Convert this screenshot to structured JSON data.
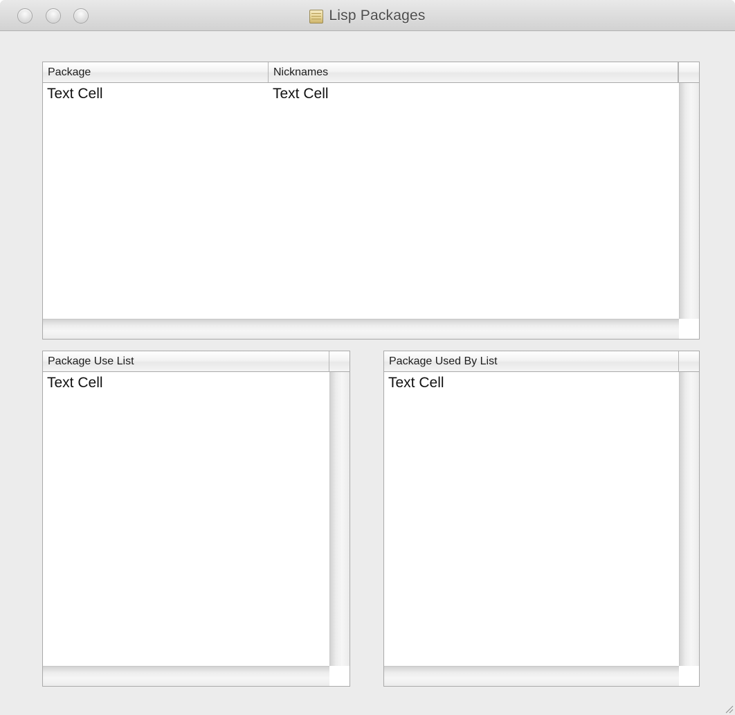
{
  "window": {
    "title": "Lisp Packages"
  },
  "packages_table": {
    "columns": [
      "Package",
      "Nicknames"
    ],
    "rows": [
      [
        "Text Cell",
        "Text Cell"
      ]
    ]
  },
  "use_list_table": {
    "column": "Package Use List",
    "rows": [
      "Text Cell"
    ]
  },
  "used_by_table": {
    "column": "Package Used By List",
    "rows": [
      "Text Cell"
    ]
  },
  "colors": {
    "window_background": "#ececec",
    "table_border": "#a9a9a9"
  }
}
